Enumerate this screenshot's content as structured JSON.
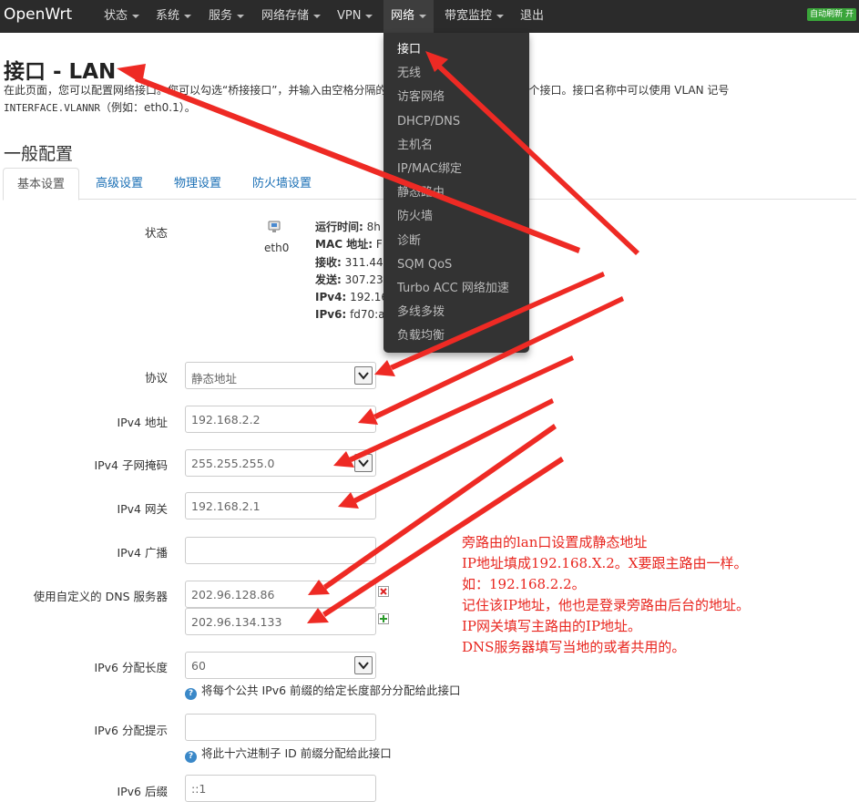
{
  "navbar": {
    "brand": "OpenWrt",
    "menu": [
      {
        "label": "状态",
        "caret": true
      },
      {
        "label": "系统",
        "caret": true
      },
      {
        "label": "服务",
        "caret": true
      },
      {
        "label": "网络存储",
        "caret": true
      },
      {
        "label": "VPN",
        "caret": true
      },
      {
        "label": "网络",
        "caret": true,
        "active": true
      },
      {
        "label": "带宽监控",
        "caret": true
      },
      {
        "label": "退出",
        "caret": false
      }
    ],
    "refresh_badge": "自动刷新 开"
  },
  "dropdown": {
    "items": [
      "接口",
      "无线",
      "访客网络",
      "DHCP/DNS",
      "主机名",
      "IP/MAC绑定",
      "静态路由",
      "防火墙",
      "诊断",
      "SQM QoS",
      "Turbo ACC 网络加速",
      "多线多拨",
      "负载均衡"
    ]
  },
  "page": {
    "title": "接口 - LAN",
    "desc_line1": "在此页面，您可以配置网络接口。您可以勾选“桥接接口”，并输入由空格分隔的多个网络接口的名称来桥接多个接口。接口名称中可以使用 VLAN 记号",
    "desc_mono": "INTERFACE.VLANNR",
    "desc_line2_rest": "（例如：eth0.1）。",
    "section_title": "一般配置"
  },
  "tabs": [
    "基本设置",
    "高级设置",
    "物理设置",
    "防火墙设置"
  ],
  "status": {
    "label": "状态",
    "iface": "eth0",
    "lines": [
      {
        "key": "运行时间:",
        "val": "8h"
      },
      {
        "key": "MAC 地址:",
        "val": "F"
      },
      {
        "key": "接收:",
        "val": "311.44"
      },
      {
        "key": "发送:",
        "val": "307.23"
      },
      {
        "key": "IPv4:",
        "val": "192.16"
      },
      {
        "key": "IPv6:",
        "val": "fd70:a8"
      }
    ]
  },
  "form": {
    "protocol": {
      "label": "协议",
      "value": "静态地址"
    },
    "ipv4_addr": {
      "label": "IPv4 地址",
      "value": "192.168.2.2"
    },
    "ipv4_mask": {
      "label": "IPv4 子网掩码",
      "value": "255.255.255.0"
    },
    "ipv4_gw": {
      "label": "IPv4 网关",
      "value": "192.168.2.1"
    },
    "ipv4_bcast": {
      "label": "IPv4 广播",
      "value": ""
    },
    "dns": {
      "label": "使用自定义的 DNS 服务器",
      "values": [
        "202.96.128.86",
        "202.96.134.133"
      ]
    },
    "ip6_len": {
      "label": "IPv6 分配长度",
      "value": "60",
      "help": "将每个公共 IPv6 前缀的给定长度部分分配给此接口"
    },
    "ip6_hint": {
      "label": "IPv6 分配提示",
      "value": "",
      "help": "将此十六进制子 ID 前缀分配给此接口"
    },
    "ip6_suffix": {
      "label": "IPv6 后缀",
      "value": "::1"
    }
  },
  "annotation": {
    "lines": [
      "旁路由的lan口设置成静态地址",
      "IP地址填成192.168.X.2。X要跟主路由一样。",
      "如：192.168.2.2。",
      "记住该IP地址，他也是登录旁路由后台的地址。",
      "IP网关填写主路由的IP地址。",
      "DNS服务器填写当地的或者共用的。"
    ],
    "color": "#e8261f"
  }
}
